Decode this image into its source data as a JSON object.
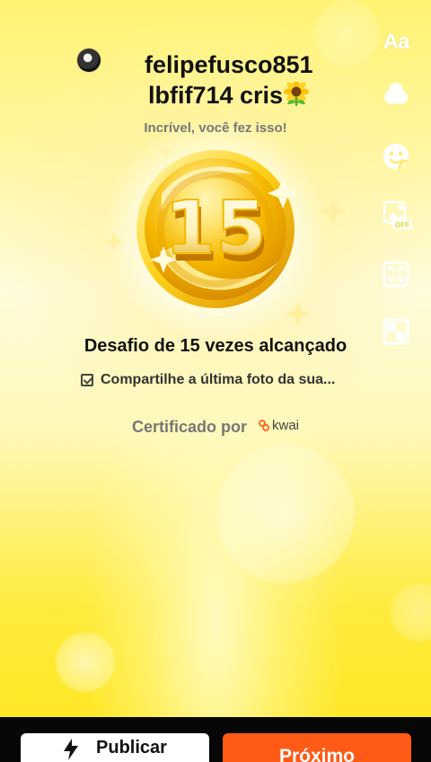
{
  "profile": {
    "username_line_1": "felipefusco851",
    "username_line_2": "lbfif714 cris",
    "emoji_icon": "sunflower-icon"
  },
  "achievement": {
    "subtitle": "Incrível, você fez isso!",
    "number": "15",
    "title": "Desafio de 15 vezes alcançado",
    "description": "Compartilhe a última foto da sua..."
  },
  "certificate": {
    "text": "Certificado por",
    "brand": "kwai"
  },
  "side_tools": {
    "text_label": "Aa",
    "photo_badge": "OFF",
    "icons": [
      "text-icon",
      "filter-icon",
      "sticker-icon",
      "photo-off-icon",
      "expand-icon",
      "crop-icon"
    ]
  },
  "footer": {
    "publish_label": "Publicar",
    "next_label": "Próximo"
  },
  "colors": {
    "background_top": "#fff372",
    "background_bottom": "#ffe71f",
    "medal_gold": "#f4b400",
    "next_button": "#ff5a16",
    "footer": "#070707"
  }
}
